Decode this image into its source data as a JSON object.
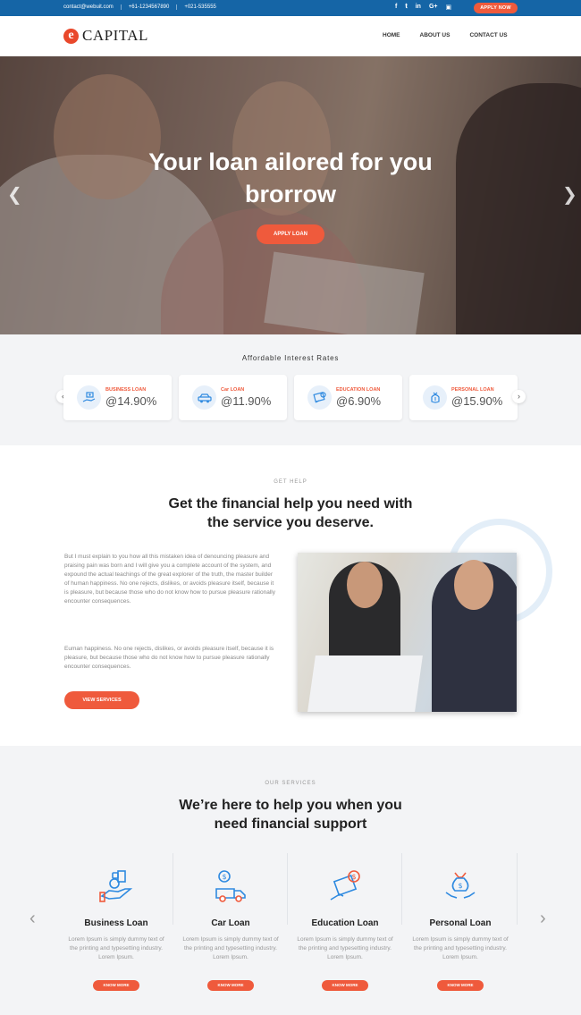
{
  "topbar": {
    "email": "contact@webuit.com",
    "phone1": "+61-1234567890",
    "phone2": "+021-535555",
    "social": [
      "facebook-icon",
      "twitter-icon",
      "linkedin-icon",
      "googleplus-icon",
      "instagram-icon"
    ],
    "apply_label": "APPLY NOW"
  },
  "header": {
    "logo_mark": "e",
    "logo_text": "CAPITAL",
    "nav": [
      "HOME",
      "ABOUT US",
      "CONTACT US"
    ]
  },
  "hero": {
    "title_line1": "Your loan ailored for you",
    "title_line2": "brorrow",
    "cta_label": "APPLY LOAN"
  },
  "rates": {
    "title": "Affordable Interest Rates",
    "items": [
      {
        "label": "BUSINESS LOAN",
        "value": "@14.90%"
      },
      {
        "label": "Car LOAN",
        "value": "@11.90%"
      },
      {
        "label": "EDUCATION LOAN",
        "value": "@6.90%"
      },
      {
        "label": "PERSONAL LOAN",
        "value": "@15.90%"
      }
    ]
  },
  "help": {
    "eyebrow": "GET HELP",
    "title_line1": "Get the financial help you need with",
    "title_line2": "the service you deserve.",
    "para1": "But I must explain to you how all this mistaken idea of denouncing pleasure and praising pain was born and I will give you a complete account of the system, and expound the actual teachings of the great explorer of the truth, the master builder of human happiness. No one rejects, dislikes, or avoids pleasure itself, because it is pleasure, but because those who do not know how to pursue pleasure rationally encounter consequences.",
    "para2": "Euman happiness. No one rejects, dislikes, or avoids pleasure itself, because it is pleasure, but because those who do not know how to pursue pleasure rationally encounter consequences.",
    "button": "VIEW SERVICES"
  },
  "services": {
    "eyebrow": "OUR SERVICES",
    "title_line1": "We’re here to help you when you",
    "title_line2": "need financial support",
    "items": [
      {
        "name": "Business Loan",
        "desc": "Lorem Ipsum is simply dummy text of the printing and typesetting industry. Lorem Ipsum.",
        "button": "KNOW MORE"
      },
      {
        "name": "Car Loan",
        "desc": "Lorem Ipsum is simply dummy text of the printing and typesetting industry. Lorem Ipsum.",
        "button": "KNOW MORE"
      },
      {
        "name": "Education Loan",
        "desc": "Lorem Ipsum is simply dummy text of the printing and typesetting industry. Lorem Ipsum.",
        "button": "KNOW MORE"
      },
      {
        "name": "Personal Loan",
        "desc": "Lorem Ipsum is simply dummy text of the printing and typesetting industry. Lorem Ipsum.",
        "button": "KNOW MORE"
      }
    ]
  },
  "colors": {
    "topbar": "#1565a6",
    "accent": "#ef5a3c",
    "icon_blue": "#2f8ae0"
  }
}
